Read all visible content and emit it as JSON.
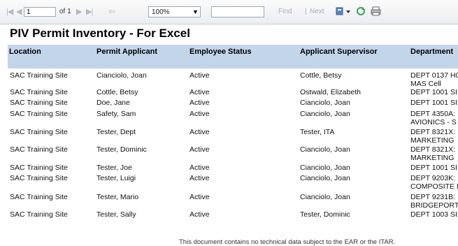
{
  "toolbar": {
    "page_value": "1",
    "page_of": "of 1",
    "zoom_value": "100%",
    "find_value": "",
    "find_label": "Find",
    "separator": "|",
    "next_label": "Next",
    "icons": [
      "first-page-icon",
      "previous-page-icon",
      "next-page-icon",
      "last-page-icon",
      "back-icon",
      "export-icon",
      "refresh-icon",
      "print-icon"
    ]
  },
  "report": {
    "title": "PIV Permit Inventory - For Excel",
    "columns": [
      "Location",
      "Permit Applicant",
      "Employee Status",
      "Applicant Supervisor",
      "Department"
    ],
    "rows": [
      {
        "location": "SAC Training Site",
        "applicant": "Cianciolo, Joan",
        "status": "Active",
        "supervisor": "Cottle, Betsy",
        "dept1": "DEPT 0137 H0",
        "dept2": "MAS Cell"
      },
      {
        "location": "SAC Training Site",
        "applicant": "Cottle, Betsy",
        "status": "Active",
        "supervisor": "Ostwald, Elizabeth",
        "dept1": "DEPT 1001 SI",
        "dept2": ""
      },
      {
        "location": "SAC Training Site",
        "applicant": "Doe, Jane",
        "status": "Active",
        "supervisor": "Cianciolo, Joan",
        "dept1": "DEPT 1001 SI",
        "dept2": ""
      },
      {
        "location": "SAC Training Site",
        "applicant": "Safety, Sam",
        "status": "Active",
        "supervisor": "Cianciolo, Joan",
        "dept1": "DEPT 4350A:",
        "dept2": "AVIONICS - S"
      },
      {
        "location": "SAC Training Site",
        "applicant": "Tester, Dept",
        "status": "Active",
        "supervisor": "Tester, ITA",
        "dept1": "DEPT 8321X:",
        "dept2": "MARKETING"
      },
      {
        "location": "SAC Training Site",
        "applicant": "Tester, Dominic",
        "status": "Active",
        "supervisor": "Cianciolo, Joan",
        "dept1": "DEPT 8321X:",
        "dept2": "MARKETING"
      },
      {
        "location": "SAC Training Site",
        "applicant": "Tester, Joe",
        "status": "Active",
        "supervisor": "Cianciolo, Joan",
        "dept1": "DEPT 1001 SI",
        "dept2": ""
      },
      {
        "location": "SAC Training Site",
        "applicant": "Tester, Luigi",
        "status": "Active",
        "supervisor": "Cianciolo, Joan",
        "dept1": "DEPT 9203K:",
        "dept2": "COMPOSITE I"
      },
      {
        "location": "SAC Training Site",
        "applicant": "Tester, Mario",
        "status": "Active",
        "supervisor": "Cianciolo, Joan",
        "dept1": "DEPT 9231B:",
        "dept2": "BRIDGEPORT"
      },
      {
        "location": "SAC Training Site",
        "applicant": "Tester, Sally",
        "status": "Active",
        "supervisor": "Tester, Dominic",
        "dept1": "DEPT 1003 SI",
        "dept2": ""
      }
    ],
    "footer": "This document contains no technical data subject to the EAR or the ITAR."
  }
}
